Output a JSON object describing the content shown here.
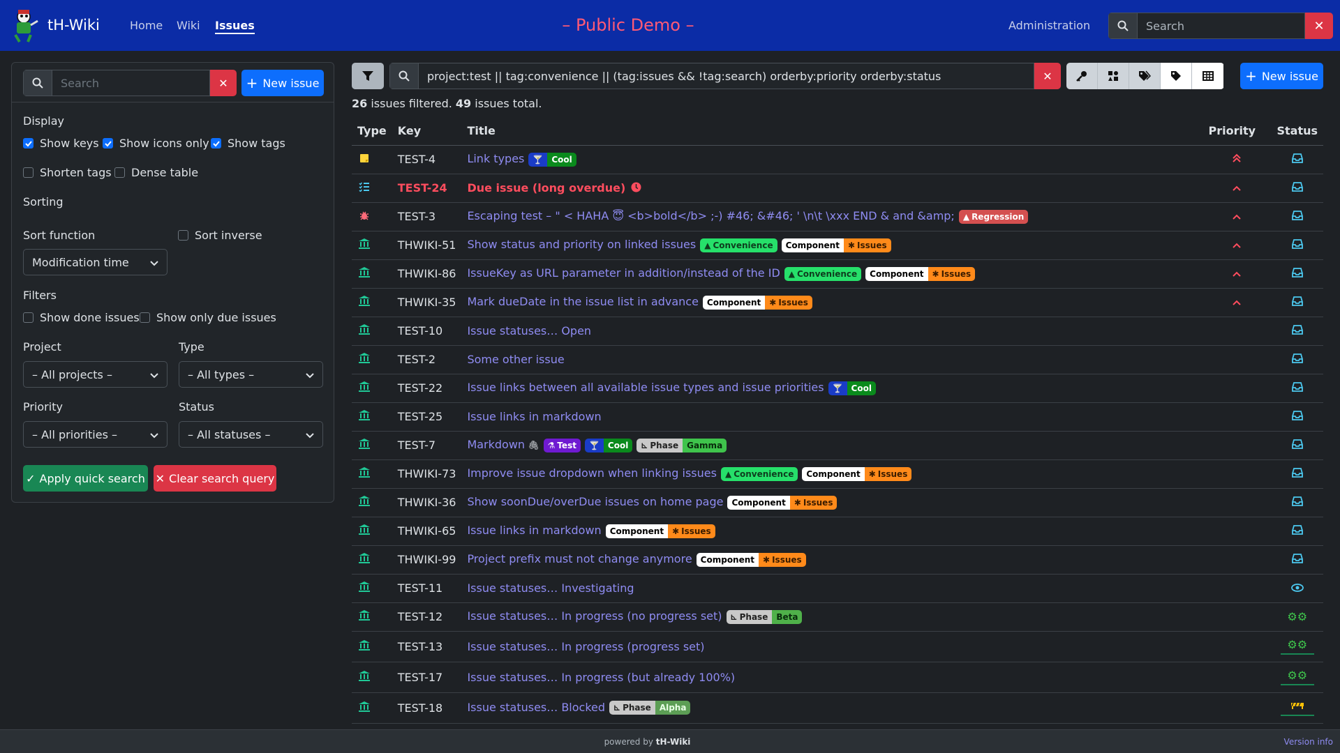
{
  "navbar": {
    "brand": "tH-Wiki",
    "links": [
      "Home",
      "Wiki",
      "Issues"
    ],
    "demo_title": "– Public Demo –",
    "admin": "Administration",
    "search_placeholder": "Search"
  },
  "sidebar": {
    "search_placeholder": "Search",
    "new_issue": "New issue",
    "display_label": "Display",
    "show_keys": "Show keys",
    "show_icons_only": "Show icons only",
    "show_tags": "Show tags",
    "shorten_tags": "Shorten tags",
    "dense_table": "Dense table",
    "sorting_label": "Sorting",
    "sort_function_label": "Sort function",
    "sort_inverse": "Sort inverse",
    "sort_function_value": "Modification time",
    "filters_label": "Filters",
    "show_done": "Show done issues",
    "show_due": "Show only due issues",
    "project_label": "Project",
    "type_label": "Type",
    "project_value": "– All projects –",
    "type_value": "– All types –",
    "priority_label": "Priority",
    "status_label": "Status",
    "priority_value": "– All priorities –",
    "status_value": "– All statuses –",
    "apply": "Apply quick search",
    "clear": "Clear search query"
  },
  "main": {
    "query": "project:test || tag:convenience || (tag:issues && !tag:search) orderby:priority orderby:status",
    "new_issue": "New issue",
    "filtered_count": "26",
    "filtered_text": " issues filtered. ",
    "total_count": "49",
    "total_text": " issues total.",
    "columns": [
      "Type",
      "Key",
      "Title",
      "Priority",
      "Status"
    ]
  },
  "issues": [
    {
      "key": "TEST-4",
      "title": "Link types",
      "badges": "Cool"
    },
    {
      "key": "TEST-24",
      "title": "Due issue (long overdue)",
      "badges": ""
    },
    {
      "key": "TEST-3",
      "title": "Escaping test – \" < HAHA 😇 <b>bold</b> ;-) #46; &#46; ' \\n\\t \\xxx END & and &amp;",
      "badges": "Regression"
    },
    {
      "key": "THWIKI-51",
      "title": "Show status and priority on linked issues",
      "badges": "Convenience, Component Issues"
    },
    {
      "key": "THWIKI-86",
      "title": "IssueKey as URL parameter in addition/instead of the ID",
      "badges": "Convenience, Component Issues"
    },
    {
      "key": "THWIKI-35",
      "title": "Mark dueDate in the issue list in advance",
      "badges": "Component Issues"
    },
    {
      "key": "TEST-10",
      "title": "Issue statuses… Open",
      "badges": ""
    },
    {
      "key": "TEST-2",
      "title": "Some other issue",
      "badges": ""
    },
    {
      "key": "TEST-22",
      "title": "Issue links between all available issue types and issue priorities",
      "badges": "Cool"
    },
    {
      "key": "TEST-25",
      "title": "Issue links in markdown",
      "badges": ""
    },
    {
      "key": "TEST-7",
      "title": "Markdown",
      "badges": "Test, Cool, Phase Gamma"
    },
    {
      "key": "THWIKI-73",
      "title": "Improve issue dropdown when linking issues",
      "badges": "Convenience, Component Issues"
    },
    {
      "key": "THWIKI-36",
      "title": "Show soonDue/overDue issues on home page",
      "badges": "Component Issues"
    },
    {
      "key": "THWIKI-65",
      "title": "Issue links in markdown",
      "badges": "Component Issues"
    },
    {
      "key": "THWIKI-99",
      "title": "Project prefix must not change anymore",
      "badges": "Component Issues"
    },
    {
      "key": "TEST-11",
      "title": "Issue statuses… Investigating",
      "badges": ""
    },
    {
      "key": "TEST-12",
      "title": "Issue statuses… In progress (no progress set)",
      "badges": "Phase Beta"
    },
    {
      "key": "TEST-13",
      "title": "Issue statuses… In progress (progress set)",
      "badges": ""
    },
    {
      "key": "TEST-17",
      "title": "Issue statuses… In progress (but already 100%)",
      "badges": ""
    },
    {
      "key": "TEST-18",
      "title": "Issue statuses… Blocked",
      "badges": "Phase Alpha"
    }
  ],
  "badge_text": {
    "cool": "Cool",
    "regression": "Regression",
    "convenience": "Convenience",
    "component": "Component",
    "issues": "Issues",
    "test": "Test",
    "phase": "Phase",
    "gamma": "Gamma",
    "beta": "Beta",
    "alpha": "Alpha"
  },
  "footer": {
    "powered": "powered by ",
    "brand": "tH-Wiki",
    "version": "Version info"
  },
  "colors": {
    "navbar": "#0b2ca6",
    "accent": "#0d6efd",
    "link": "#8f8cf2",
    "danger": "#dc3545",
    "success": "#198754"
  }
}
